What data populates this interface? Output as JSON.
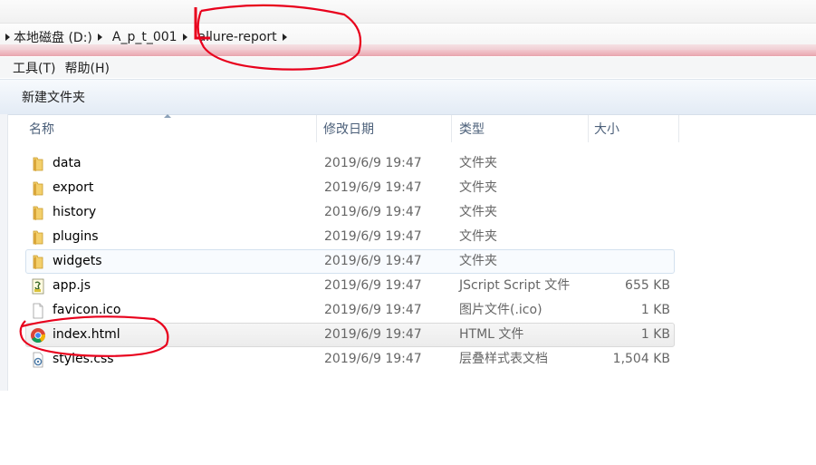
{
  "breadcrumb": [
    {
      "label": "本地磁盘 (D:)"
    },
    {
      "label": "A_p_t_001"
    },
    {
      "label": "allure-report"
    }
  ],
  "menu": [
    {
      "label": "工具(T)"
    },
    {
      "label": "帮助(H)"
    }
  ],
  "toolbar": {
    "new_folder_label": "新建文件夹"
  },
  "columns": {
    "name": "名称",
    "date": "修改日期",
    "type": "类型",
    "size": "大小"
  },
  "files": [
    {
      "name": "data",
      "date": "2019/6/9 19:47",
      "type": "文件夹",
      "size": "",
      "icon": "folder-icon"
    },
    {
      "name": "export",
      "date": "2019/6/9 19:47",
      "type": "文件夹",
      "size": "",
      "icon": "folder-icon"
    },
    {
      "name": "history",
      "date": "2019/6/9 19:47",
      "type": "文件夹",
      "size": "",
      "icon": "folder-icon"
    },
    {
      "name": "plugins",
      "date": "2019/6/9 19:47",
      "type": "文件夹",
      "size": "",
      "icon": "folder-icon"
    },
    {
      "name": "widgets",
      "date": "2019/6/9 19:47",
      "type": "文件夹",
      "size": "",
      "icon": "folder-icon"
    },
    {
      "name": "app.js",
      "date": "2019/6/9 19:47",
      "type": "JScript Script 文件",
      "size": "655 KB",
      "icon": "script-file-icon"
    },
    {
      "name": "favicon.ico",
      "date": "2019/6/9 19:47",
      "type": "图片文件(.ico)",
      "size": "1 KB",
      "icon": "blank-file-icon"
    },
    {
      "name": "index.html",
      "date": "2019/6/9 19:47",
      "type": "HTML 文件",
      "size": "1 KB",
      "icon": "chrome-icon"
    },
    {
      "name": "styles.css",
      "date": "2019/6/9 19:47",
      "type": "层叠样式表文档",
      "size": "1,504 KB",
      "icon": "css-file-icon"
    }
  ],
  "colors": {
    "annotation": "#e8001c",
    "folder": "#e9b949",
    "header_text": "#4c607a"
  }
}
